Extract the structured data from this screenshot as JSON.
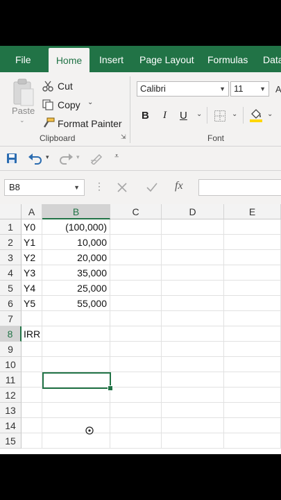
{
  "ribbon_tabs": [
    "File",
    "Home",
    "Insert",
    "Page Layout",
    "Formulas",
    "Data"
  ],
  "active_tab": "Home",
  "clipboard": {
    "paste_label": "Paste",
    "cut_label": "Cut",
    "copy_label": "Copy",
    "format_painter_label": "Format Painter",
    "group_label": "Clipboard"
  },
  "font": {
    "name": "Calibri",
    "size": "11",
    "bold_label": "B",
    "italic_label": "I",
    "underline_label": "U",
    "group_label": "Font"
  },
  "formula_bar": {
    "name_box": "B8",
    "fx_label": "fx",
    "formula": ""
  },
  "grid": {
    "columns": [
      "A",
      "B",
      "C",
      "D",
      "E"
    ],
    "selected_column": "B",
    "rows": [
      "1",
      "2",
      "3",
      "4",
      "5",
      "6",
      "7",
      "8",
      "9",
      "10",
      "11",
      "12",
      "13",
      "14",
      "15"
    ],
    "selected_row": "8",
    "cells": {
      "A1": "Y0",
      "B1": "(100,000)",
      "A2": "Y1",
      "B2": "10,000",
      "A3": "Y2",
      "B3": "20,000",
      "A4": "Y3",
      "B4": "35,000",
      "A5": "Y4",
      "B5": "25,000",
      "A6": "Y5",
      "B6": "55,000",
      "A8": "IRR"
    }
  },
  "colors": {
    "excel_green": "#217346",
    "ribbon_bg": "#f3f2f1",
    "fill_yellow": "#ffd700"
  }
}
